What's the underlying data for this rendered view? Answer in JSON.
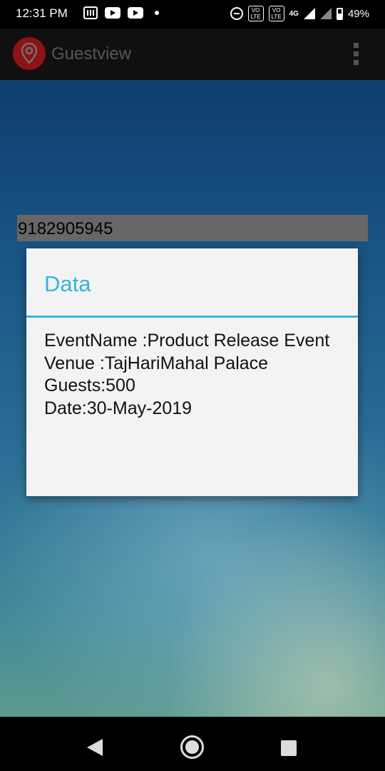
{
  "status_bar": {
    "time": "12:31 PM",
    "volte1": "VO LTE",
    "volte2": "VO LTE",
    "network": "4G",
    "battery": "49%",
    "icons": [
      "notification-box-icon",
      "youtube-icon",
      "youtube-icon",
      "dot-icon",
      "dnd-icon",
      "volte-icon",
      "volte-icon",
      "signal-icon",
      "signal-icon",
      "battery-icon"
    ]
  },
  "app_bar": {
    "title": "Guestview",
    "logo_icon": "location-pin-icon",
    "menu_icon": "overflow-menu-icon"
  },
  "phone_field": {
    "value": "9182905945"
  },
  "dialog": {
    "title": "Data",
    "lines": [
      "EventName :Product Release Event",
      "Venue :TajHariMahal Palace",
      "Guests:500",
      "Date:30-May-2019"
    ]
  },
  "nav_bar": {
    "icons": [
      "back-icon",
      "home-icon",
      "recents-icon"
    ]
  },
  "colors": {
    "accent": "#35b4de",
    "logo": "#8e1216",
    "app_bar": "#101010"
  }
}
